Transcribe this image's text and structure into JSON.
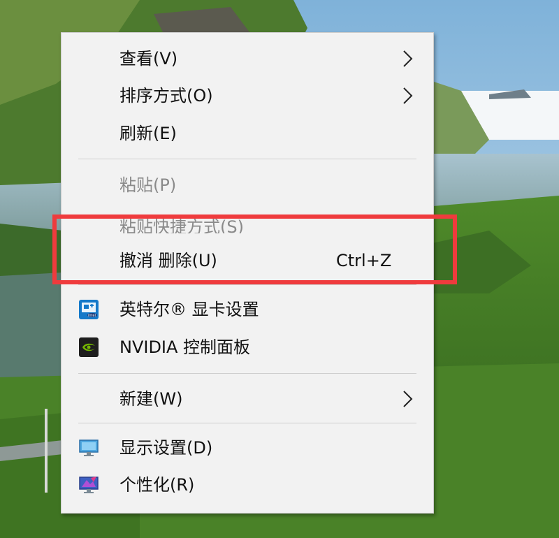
{
  "context_menu": {
    "items": [
      {
        "label": "查看(V)"
      },
      {
        "label": "排序方式(O)"
      },
      {
        "label": "刷新(E)"
      },
      {
        "label": "粘贴(P)"
      },
      {
        "label": "粘贴快捷方式(S)"
      },
      {
        "label": "撤消 删除(U)",
        "shortcut": "Ctrl+Z"
      },
      {
        "label": "英特尔® 显卡设置",
        "icon": "intel-graphics-icon"
      },
      {
        "label": "NVIDIA 控制面板",
        "icon": "nvidia-icon"
      },
      {
        "label": "新建(W)"
      },
      {
        "label": "显示设置(D)",
        "icon": "display-settings-icon"
      },
      {
        "label": "个性化(R)",
        "icon": "personalize-icon"
      }
    ]
  },
  "highlight_color": "#ef3b3d",
  "menu_background": "#f2f2f2"
}
